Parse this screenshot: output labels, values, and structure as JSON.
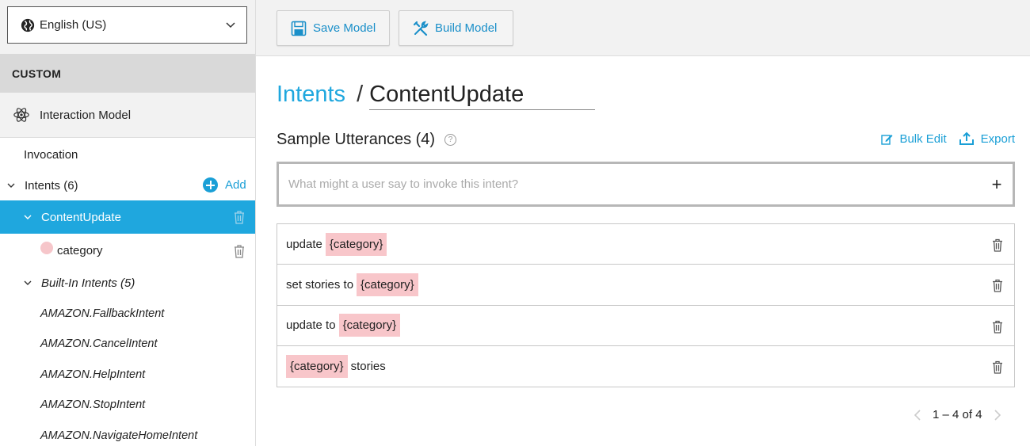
{
  "language_select": {
    "value": "English (US)",
    "icon": "globe-icon"
  },
  "sidebar": {
    "section_label": "CUSTOM",
    "interaction_model_label": "Interaction Model",
    "invocation_label": "Invocation",
    "intents_label": "Intents (6)",
    "add_label": "Add",
    "active_intent": "ContentUpdate",
    "slot_label": "category",
    "builtin_label": "Built-In Intents (5)",
    "builtin_intents": [
      "AMAZON.FallbackIntent",
      "AMAZON.CancelIntent",
      "AMAZON.HelpIntent",
      "AMAZON.StopIntent",
      "AMAZON.NavigateHomeIntent"
    ]
  },
  "toolbar": {
    "save_label": "Save Model",
    "build_label": "Build Model"
  },
  "breadcrumb": {
    "parent": "Intents",
    "separator": "/",
    "current": "ContentUpdate"
  },
  "utterances": {
    "title": "Sample Utterances (4)",
    "help": "?",
    "bulk_edit_label": "Bulk Edit",
    "export_label": "Export",
    "input_placeholder": "What might a user say to invoke this intent?",
    "add_symbol": "+",
    "rows": [
      [
        {
          "text": "update",
          "slot": false
        },
        {
          "text": "{category}",
          "slot": true
        }
      ],
      [
        {
          "text": "set stories to",
          "slot": false
        },
        {
          "text": "{category}",
          "slot": true
        }
      ],
      [
        {
          "text": "update to",
          "slot": false
        },
        {
          "text": "{category}",
          "slot": true
        }
      ],
      [
        {
          "text": "{category}",
          "slot": true
        },
        {
          "text": "stories",
          "slot": false
        }
      ]
    ]
  },
  "pagination": {
    "text": "1 – 4 of 4"
  },
  "colors": {
    "accent": "#1fa7de",
    "slot_highlight": "#f8c6ca",
    "active_bg": "#1fa7de"
  }
}
